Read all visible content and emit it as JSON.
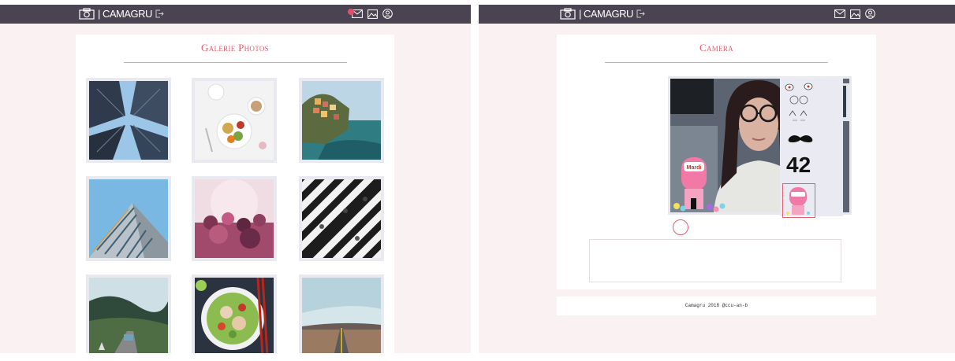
{
  "app": {
    "brand": "| CAMAGRU"
  },
  "gallery": {
    "title": "Galerie Photos",
    "photos": [
      {
        "name": "skyscrapers"
      },
      {
        "name": "breakfast"
      },
      {
        "name": "cliff-town"
      },
      {
        "name": "pyramid-building"
      },
      {
        "name": "color-festival"
      },
      {
        "name": "crosswalk"
      },
      {
        "name": "mountain-road"
      },
      {
        "name": "salad-bowl"
      },
      {
        "name": "desert-road"
      }
    ]
  },
  "camera": {
    "title": "Camera",
    "filters": [
      "puppy-ears",
      "cat-face",
      "mustache",
      "42-logo",
      "mardi-gumball"
    ],
    "gumball_label": "Mardi",
    "filter_42_label": "42"
  },
  "footer": {
    "text": "Camagru 2018 @ccu-an-b"
  },
  "colors": {
    "topbar": "#4a4452",
    "accent": "#e0606e",
    "background": "#faf2f2",
    "notification": "#e94b6a"
  },
  "icons": [
    "camera-icon",
    "logout-icon",
    "mail-icon",
    "gallery-icon",
    "profile-icon"
  ]
}
